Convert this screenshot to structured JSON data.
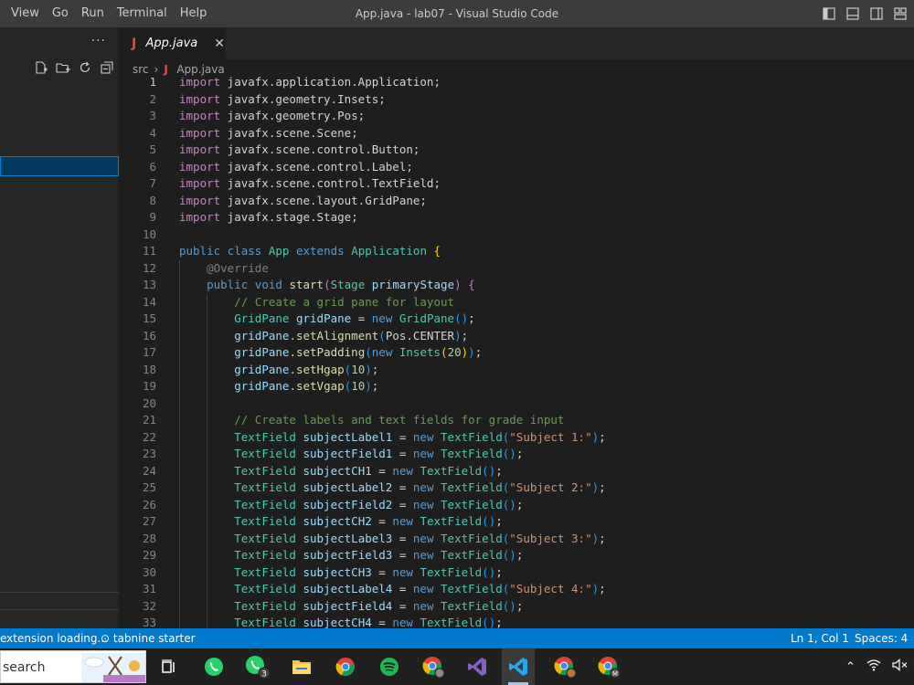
{
  "titlebar": {
    "menu": [
      "View",
      "Go",
      "Run",
      "Terminal",
      "Help"
    ],
    "title": "App.java - lab07 - Visual Studio Code",
    "layout_icons": [
      "toggle-sidebar-icon",
      "toggle-panel-icon",
      "toggle-secondary-sidebar-icon",
      "customize-layout-icon"
    ]
  },
  "sidebar": {
    "more_label": "···",
    "actions": [
      "new-file-icon",
      "new-folder-icon",
      "refresh-icon",
      "collapse-all-icon"
    ]
  },
  "tab": {
    "icon": "J",
    "label": "App.java",
    "close": "✕"
  },
  "breadcrumb": {
    "folder": "src",
    "separator": "›",
    "icon": "J",
    "file": "App.java"
  },
  "editor": {
    "current_line": 1,
    "lines": [
      [
        [
          "kw2",
          "import"
        ],
        [
          "pl",
          " javafx.application.Application;"
        ]
      ],
      [
        [
          "kw2",
          "import"
        ],
        [
          "pl",
          " javafx.geometry.Insets;"
        ]
      ],
      [
        [
          "kw2",
          "import"
        ],
        [
          "pl",
          " javafx.geometry.Pos;"
        ]
      ],
      [
        [
          "kw2",
          "import"
        ],
        [
          "pl",
          " javafx.scene.Scene;"
        ]
      ],
      [
        [
          "kw2",
          "import"
        ],
        [
          "pl",
          " javafx.scene.control.Button;"
        ]
      ],
      [
        [
          "kw2",
          "import"
        ],
        [
          "pl",
          " javafx.scene.control.Label;"
        ]
      ],
      [
        [
          "kw2",
          "import"
        ],
        [
          "pl",
          " javafx.scene.control.TextField;"
        ]
      ],
      [
        [
          "kw2",
          "import"
        ],
        [
          "pl",
          " javafx.scene.layout.GridPane;"
        ]
      ],
      [
        [
          "kw2",
          "import"
        ],
        [
          "pl",
          " javafx.stage.Stage;"
        ]
      ],
      [],
      [
        [
          "kw",
          "public"
        ],
        [
          "pl",
          " "
        ],
        [
          "kw",
          "class"
        ],
        [
          "pl",
          " "
        ],
        [
          "ty",
          "App"
        ],
        [
          "pl",
          " "
        ],
        [
          "kw",
          "extends"
        ],
        [
          "pl",
          " "
        ],
        [
          "ty",
          "Application"
        ],
        [
          "pl",
          " "
        ],
        [
          "br1",
          "{"
        ]
      ],
      [
        [
          "pl",
          "    "
        ],
        [
          "ann",
          "@Override"
        ]
      ],
      [
        [
          "pl",
          "    "
        ],
        [
          "kw",
          "public"
        ],
        [
          "pl",
          " "
        ],
        [
          "kw",
          "void"
        ],
        [
          "pl",
          " "
        ],
        [
          "fn",
          "start"
        ],
        [
          "br2",
          "("
        ],
        [
          "ty",
          "Stage"
        ],
        [
          "pl",
          " "
        ],
        [
          "var",
          "primaryStage"
        ],
        [
          "br2",
          ")"
        ],
        [
          "pl",
          " "
        ],
        [
          "br2",
          "{"
        ]
      ],
      [
        [
          "pl",
          "        "
        ],
        [
          "cm",
          "// Create a grid pane for layout"
        ]
      ],
      [
        [
          "pl",
          "        "
        ],
        [
          "ty",
          "GridPane"
        ],
        [
          "pl",
          " "
        ],
        [
          "var",
          "gridPane"
        ],
        [
          "pl",
          " = "
        ],
        [
          "kw",
          "new"
        ],
        [
          "pl",
          " "
        ],
        [
          "ty",
          "GridPane"
        ],
        [
          "br3",
          "("
        ],
        [
          "br3",
          ")"
        ],
        [
          "pl",
          ";"
        ]
      ],
      [
        [
          "pl",
          "        "
        ],
        [
          "var",
          "gridPane"
        ],
        [
          "pl",
          "."
        ],
        [
          "fn",
          "setAlignment"
        ],
        [
          "br3",
          "("
        ],
        [
          "pl",
          "Pos.CENTER"
        ],
        [
          "br3",
          ")"
        ],
        [
          "pl",
          ";"
        ]
      ],
      [
        [
          "pl",
          "        "
        ],
        [
          "var",
          "gridPane"
        ],
        [
          "pl",
          "."
        ],
        [
          "fn",
          "setPadding"
        ],
        [
          "br3",
          "("
        ],
        [
          "kw",
          "new"
        ],
        [
          "pl",
          " "
        ],
        [
          "ty",
          "Insets"
        ],
        [
          "br1",
          "("
        ],
        [
          "num",
          "20"
        ],
        [
          "br1",
          ")"
        ],
        [
          "br3",
          ")"
        ],
        [
          "pl",
          ";"
        ]
      ],
      [
        [
          "pl",
          "        "
        ],
        [
          "var",
          "gridPane"
        ],
        [
          "pl",
          "."
        ],
        [
          "fn",
          "setHgap"
        ],
        [
          "br3",
          "("
        ],
        [
          "num",
          "10"
        ],
        [
          "br3",
          ")"
        ],
        [
          "pl",
          ";"
        ]
      ],
      [
        [
          "pl",
          "        "
        ],
        [
          "var",
          "gridPane"
        ],
        [
          "pl",
          "."
        ],
        [
          "fn",
          "setVgap"
        ],
        [
          "br3",
          "("
        ],
        [
          "num",
          "10"
        ],
        [
          "br3",
          ")"
        ],
        [
          "pl",
          ";"
        ]
      ],
      [],
      [
        [
          "pl",
          "        "
        ],
        [
          "cm",
          "// Create labels and text fields for grade input"
        ]
      ],
      [
        [
          "pl",
          "        "
        ],
        [
          "ty",
          "TextField"
        ],
        [
          "pl",
          " "
        ],
        [
          "var",
          "subjectLabel1"
        ],
        [
          "pl",
          " = "
        ],
        [
          "kw",
          "new"
        ],
        [
          "pl",
          " "
        ],
        [
          "ty",
          "TextField"
        ],
        [
          "br3",
          "("
        ],
        [
          "str",
          "\"Subject 1:\""
        ],
        [
          "br3",
          ")"
        ],
        [
          "pl",
          ";"
        ]
      ],
      [
        [
          "pl",
          "        "
        ],
        [
          "ty",
          "TextField"
        ],
        [
          "pl",
          " "
        ],
        [
          "var",
          "subjectField1"
        ],
        [
          "pl",
          " = "
        ],
        [
          "kw",
          "new"
        ],
        [
          "pl",
          " "
        ],
        [
          "ty",
          "TextField"
        ],
        [
          "br3",
          "("
        ],
        [
          "br3",
          ")"
        ],
        [
          "pl",
          ";"
        ]
      ],
      [
        [
          "pl",
          "        "
        ],
        [
          "ty",
          "TextField"
        ],
        [
          "pl",
          " "
        ],
        [
          "var",
          "subjectCH1"
        ],
        [
          "pl",
          " = "
        ],
        [
          "kw",
          "new"
        ],
        [
          "pl",
          " "
        ],
        [
          "ty",
          "TextField"
        ],
        [
          "br3",
          "("
        ],
        [
          "br3",
          ")"
        ],
        [
          "pl",
          ";"
        ]
      ],
      [
        [
          "pl",
          "        "
        ],
        [
          "ty",
          "TextField"
        ],
        [
          "pl",
          " "
        ],
        [
          "var",
          "subjectLabel2"
        ],
        [
          "pl",
          " = "
        ],
        [
          "kw",
          "new"
        ],
        [
          "pl",
          " "
        ],
        [
          "ty",
          "TextField"
        ],
        [
          "br3",
          "("
        ],
        [
          "str",
          "\"Subject 2:\""
        ],
        [
          "br3",
          ")"
        ],
        [
          "pl",
          ";"
        ]
      ],
      [
        [
          "pl",
          "        "
        ],
        [
          "ty",
          "TextField"
        ],
        [
          "pl",
          " "
        ],
        [
          "var",
          "subjectField2"
        ],
        [
          "pl",
          " = "
        ],
        [
          "kw",
          "new"
        ],
        [
          "pl",
          " "
        ],
        [
          "ty",
          "TextField"
        ],
        [
          "br3",
          "("
        ],
        [
          "br3",
          ")"
        ],
        [
          "pl",
          ";"
        ]
      ],
      [
        [
          "pl",
          "        "
        ],
        [
          "ty",
          "TextField"
        ],
        [
          "pl",
          " "
        ],
        [
          "var",
          "subjectCH2"
        ],
        [
          "pl",
          " = "
        ],
        [
          "kw",
          "new"
        ],
        [
          "pl",
          " "
        ],
        [
          "ty",
          "TextField"
        ],
        [
          "br3",
          "("
        ],
        [
          "br3",
          ")"
        ],
        [
          "pl",
          ";"
        ]
      ],
      [
        [
          "pl",
          "        "
        ],
        [
          "ty",
          "TextField"
        ],
        [
          "pl",
          " "
        ],
        [
          "var",
          "subjectLabel3"
        ],
        [
          "pl",
          " = "
        ],
        [
          "kw",
          "new"
        ],
        [
          "pl",
          " "
        ],
        [
          "ty",
          "TextField"
        ],
        [
          "br3",
          "("
        ],
        [
          "str",
          "\"Subject 3:\""
        ],
        [
          "br3",
          ")"
        ],
        [
          "pl",
          ";"
        ]
      ],
      [
        [
          "pl",
          "        "
        ],
        [
          "ty",
          "TextField"
        ],
        [
          "pl",
          " "
        ],
        [
          "var",
          "subjectField3"
        ],
        [
          "pl",
          " = "
        ],
        [
          "kw",
          "new"
        ],
        [
          "pl",
          " "
        ],
        [
          "ty",
          "TextField"
        ],
        [
          "br3",
          "("
        ],
        [
          "br3",
          ")"
        ],
        [
          "pl",
          ";"
        ]
      ],
      [
        [
          "pl",
          "        "
        ],
        [
          "ty",
          "TextField"
        ],
        [
          "pl",
          " "
        ],
        [
          "var",
          "subjectCH3"
        ],
        [
          "pl",
          " = "
        ],
        [
          "kw",
          "new"
        ],
        [
          "pl",
          " "
        ],
        [
          "ty",
          "TextField"
        ],
        [
          "br3",
          "("
        ],
        [
          "br3",
          ")"
        ],
        [
          "pl",
          ";"
        ]
      ],
      [
        [
          "pl",
          "        "
        ],
        [
          "ty",
          "TextField"
        ],
        [
          "pl",
          " "
        ],
        [
          "var",
          "subjectLabel4"
        ],
        [
          "pl",
          " = "
        ],
        [
          "kw",
          "new"
        ],
        [
          "pl",
          " "
        ],
        [
          "ty",
          "TextField"
        ],
        [
          "br3",
          "("
        ],
        [
          "str",
          "\"Subject 4:\""
        ],
        [
          "br3",
          ")"
        ],
        [
          "pl",
          ";"
        ]
      ],
      [
        [
          "pl",
          "        "
        ],
        [
          "ty",
          "TextField"
        ],
        [
          "pl",
          " "
        ],
        [
          "var",
          "subjectField4"
        ],
        [
          "pl",
          " = "
        ],
        [
          "kw",
          "new"
        ],
        [
          "pl",
          " "
        ],
        [
          "ty",
          "TextField"
        ],
        [
          "br3",
          "("
        ],
        [
          "br3",
          ")"
        ],
        [
          "pl",
          ";"
        ]
      ],
      [
        [
          "pl",
          "        "
        ],
        [
          "ty",
          "TextField"
        ],
        [
          "pl",
          " "
        ],
        [
          "var",
          "subjectCH4"
        ],
        [
          "pl",
          " = "
        ],
        [
          "kw",
          "new"
        ],
        [
          "pl",
          " "
        ],
        [
          "ty",
          "TextField"
        ],
        [
          "br3",
          "("
        ],
        [
          "br3",
          ")"
        ],
        [
          "pl",
          ";"
        ]
      ]
    ]
  },
  "statusbar": {
    "left": [
      "extension loading...",
      "⊙ tabnine starter"
    ],
    "position": "Ln 1, Col 1",
    "spaces": "Spaces: 4"
  },
  "taskbar": {
    "search_label": "search",
    "apps": [
      {
        "name": "task-view-icon",
        "badge": ""
      },
      {
        "name": "whatsapp-icon",
        "badge": ""
      },
      {
        "name": "whatsapp-business-icon",
        "badge": "3"
      },
      {
        "name": "file-explorer-icon",
        "badge": ""
      },
      {
        "name": "chrome-icon",
        "badge": ""
      },
      {
        "name": "spotify-icon",
        "badge": ""
      },
      {
        "name": "chrome-profile-icon",
        "badge": ""
      },
      {
        "name": "visual-studio-icon",
        "badge": ""
      },
      {
        "name": "vscode-icon",
        "badge": ""
      },
      {
        "name": "chrome-profile-2-icon",
        "badge": ""
      },
      {
        "name": "chrome-profile-m-icon",
        "badge": "M"
      }
    ],
    "tray": [
      "⌃",
      "wifi-icon",
      "volume-icon"
    ]
  },
  "colors": {
    "status_blue": "#007acc",
    "java_red": "#f44747",
    "selection_blue": "#04395e"
  }
}
